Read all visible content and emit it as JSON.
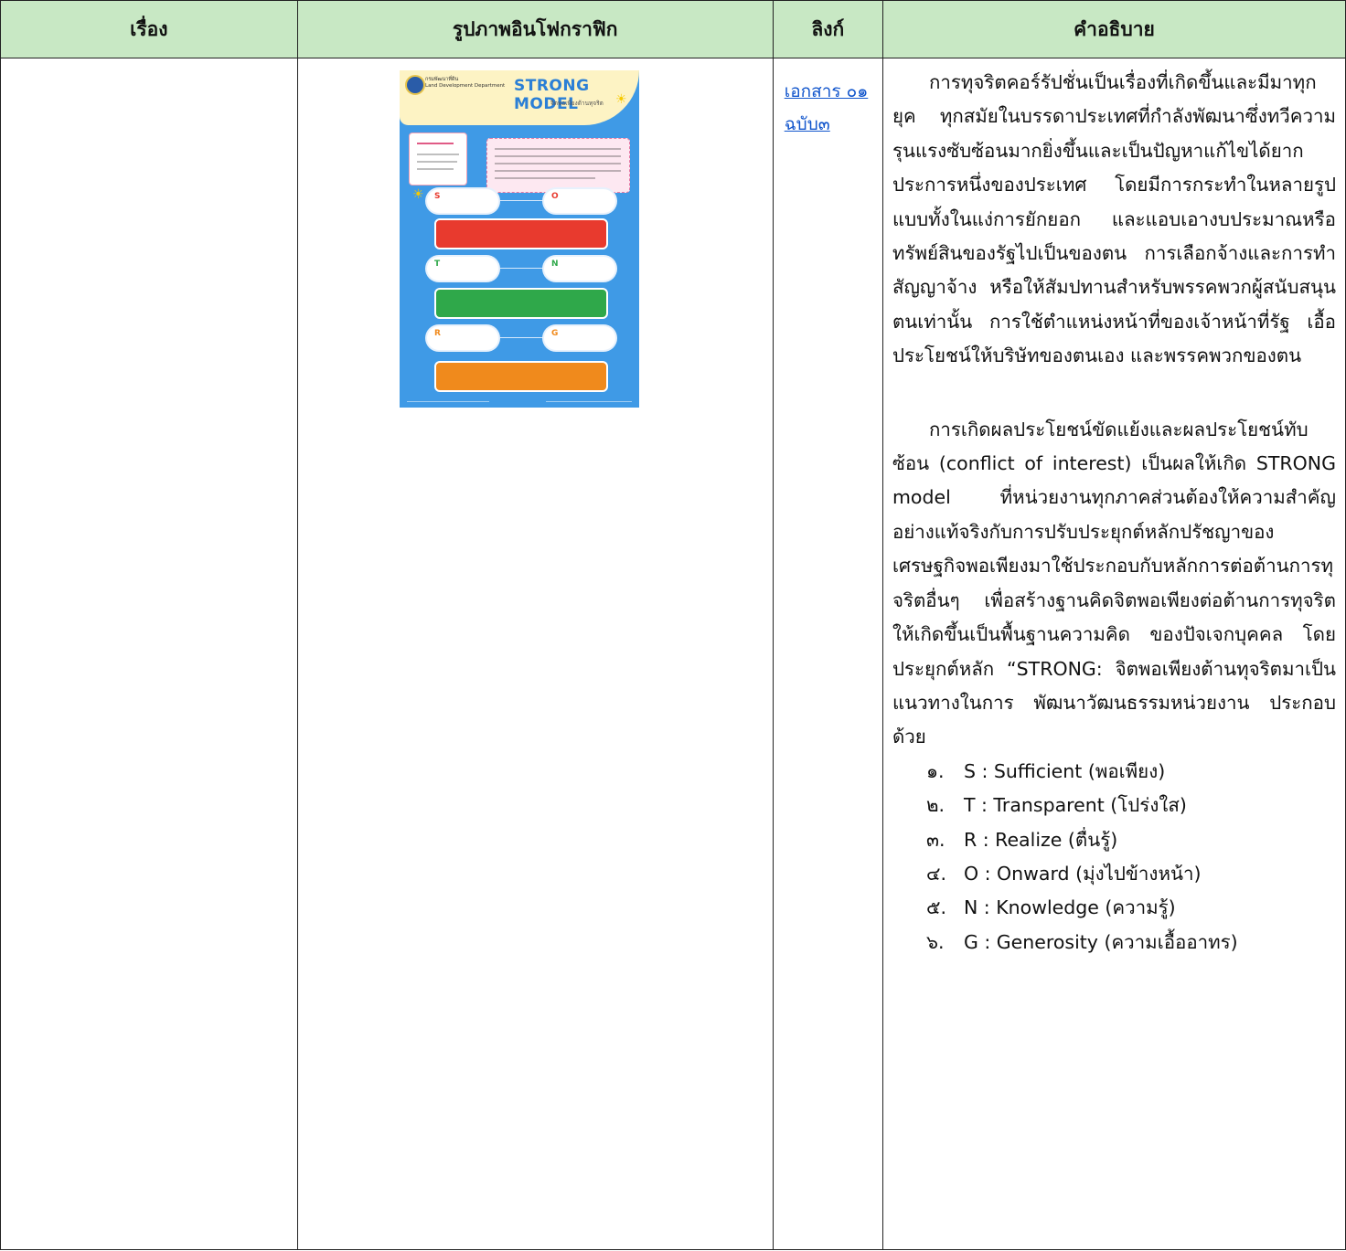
{
  "table": {
    "headers": [
      "เรื่อง",
      "รูปภาพอินโฟกราฟิก",
      "ลิงก์",
      "คำอธิบาย"
    ]
  },
  "link": {
    "label": "เอกสาร ๐๑ ฉบับ๓"
  },
  "poster": {
    "department_th": "กรมพัฒนาที่ดิน",
    "department_en": "Land Development Department",
    "title": "STRONG MODEL",
    "subtitle": "จิตพอเพียงต้านทุจริต",
    "letters": [
      "S",
      "O",
      "T",
      "N",
      "R",
      "G"
    ],
    "colors": {
      "background": "#3f9ae6",
      "title": "#2b7fd6",
      "bar_red": "#e83a2e",
      "bar_green": "#2fa84a",
      "bar_orange": "#f08a1c"
    }
  },
  "description": {
    "paragraph1": "การทุจริตคอร์รัปชั่นเป็นเรื่องที่เกิดขึ้นและมีมาทุกยุค ทุกสมัยในบรรดาประเทศที่กำลังพัฒนาซึ่งทวีความรุนแรงซับซ้อนมากยิ่งขึ้นและเป็นปัญหาแก้ไขได้ยากประการหนึ่งของประเทศ โดยมีการกระทำในหลายรูปแบบทั้งในแง่การยักยอก และแอบเอางบประมาณหรือทรัพย์สินของรัฐไปเป็นของตน การเลือกจ้างและการทำสัญญาจ้าง หรือให้สัมปทานสำหรับพรรคพวกผู้สนับสนุนตนเท่านั้น การใช้ตำแหน่งหน้าที่ของเจ้าหน้าที่รัฐ เอื้อประโยชน์ให้บริษัทของตนเอง และพรรคพวกของตน",
    "paragraph2": "การเกิดผลประโยชน์ขัดแย้งและผลประโยชน์ทับซ้อน (conflict of interest) เป็นผลให้เกิด STRONG model ที่หน่วยงานทุกภาคส่วนต้องให้ความสำคัญ อย่างแท้จริงกับการปรับประยุกต์หลักปรัชญาของเศรษฐกิจพอเพียงมาใช้ประกอบกับหลักการต่อต้านการทุจริตอื่นๆ เพื่อสร้างฐานคิดจิตพอเพียงต่อต้านการทุจริตให้เกิดขึ้นเป็นพื้นฐานความคิด ของปัจเจกบุคคล โดยประยุกต์หลัก “STRONG: จิตพอเพียงต้านทุจริตมาเป็นแนวทางในการ พัฒนาวัฒนธรรมหน่วยงาน ประกอบด้วย",
    "items": [
      {
        "num": "๑.",
        "text": "S : Sufficient (พอเพียง)"
      },
      {
        "num": "๒.",
        "text": "T : Transparent (โปร่งใส)"
      },
      {
        "num": "๓.",
        "text": "R : Realize (ตื่นรู้)"
      },
      {
        "num": "๔.",
        "text": "O : Onward (มุ่งไปข้างหน้า)"
      },
      {
        "num": "๕.",
        "text": "N : Knowledge (ความรู้)"
      },
      {
        "num": "๖.",
        "text": "G : Generosity (ความเอื้ออาทร)"
      }
    ]
  }
}
